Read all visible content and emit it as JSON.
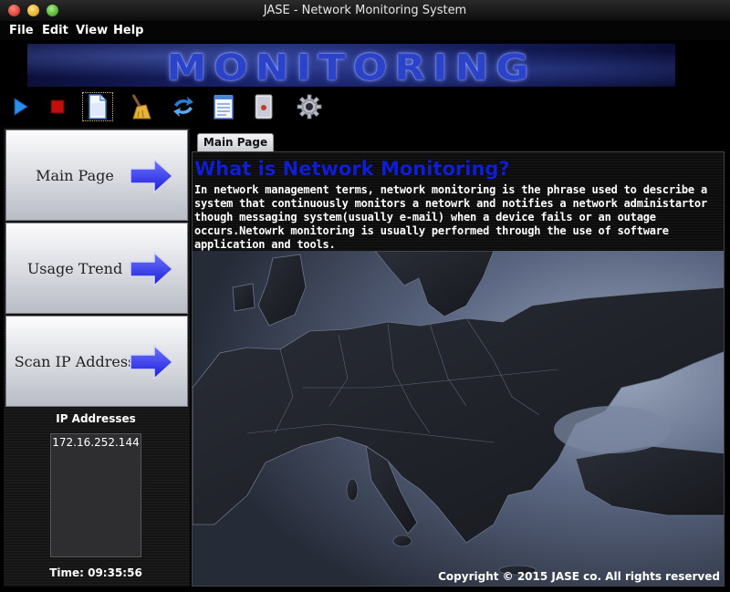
{
  "window": {
    "title": "JASE - Network Monitoring System"
  },
  "menu": {
    "items": [
      "File",
      "Edit",
      "View",
      "Help"
    ]
  },
  "banner": {
    "text": "MONITORING"
  },
  "toolbar": {
    "icons": [
      "play-icon",
      "stop-icon",
      "document-icon",
      "broom-icon",
      "refresh-icon",
      "notepad-icon",
      "report-icon",
      "gear-icon"
    ],
    "selected": "document-icon"
  },
  "sidebar": {
    "buttons": [
      {
        "label": "Main Page"
      },
      {
        "label": "Usage Trend"
      },
      {
        "label": "Scan IP Address"
      }
    ],
    "ip_title": "IP Addresses",
    "ip_list": [
      "172.16.252.144"
    ],
    "time": "Time: 09:35:56"
  },
  "main": {
    "tab": "Main Page",
    "heading": "What is Network Monitoring?",
    "paragraph": "In network management terms, network monitoring is the phrase used to describe a system that continuously monitors a netowrk and notifies a network administartor though messaging system(usually e-mail) when a device fails or an outage occurs.Netowrk monitoring is usually performed through the use of software application and tools.",
    "copyright": "Copyright © 2015 JASE co.  All rights reserved"
  },
  "colors": {
    "heading": "#0f1ed2",
    "accent_arrow": "#2a30e6",
    "background": "#000000"
  }
}
